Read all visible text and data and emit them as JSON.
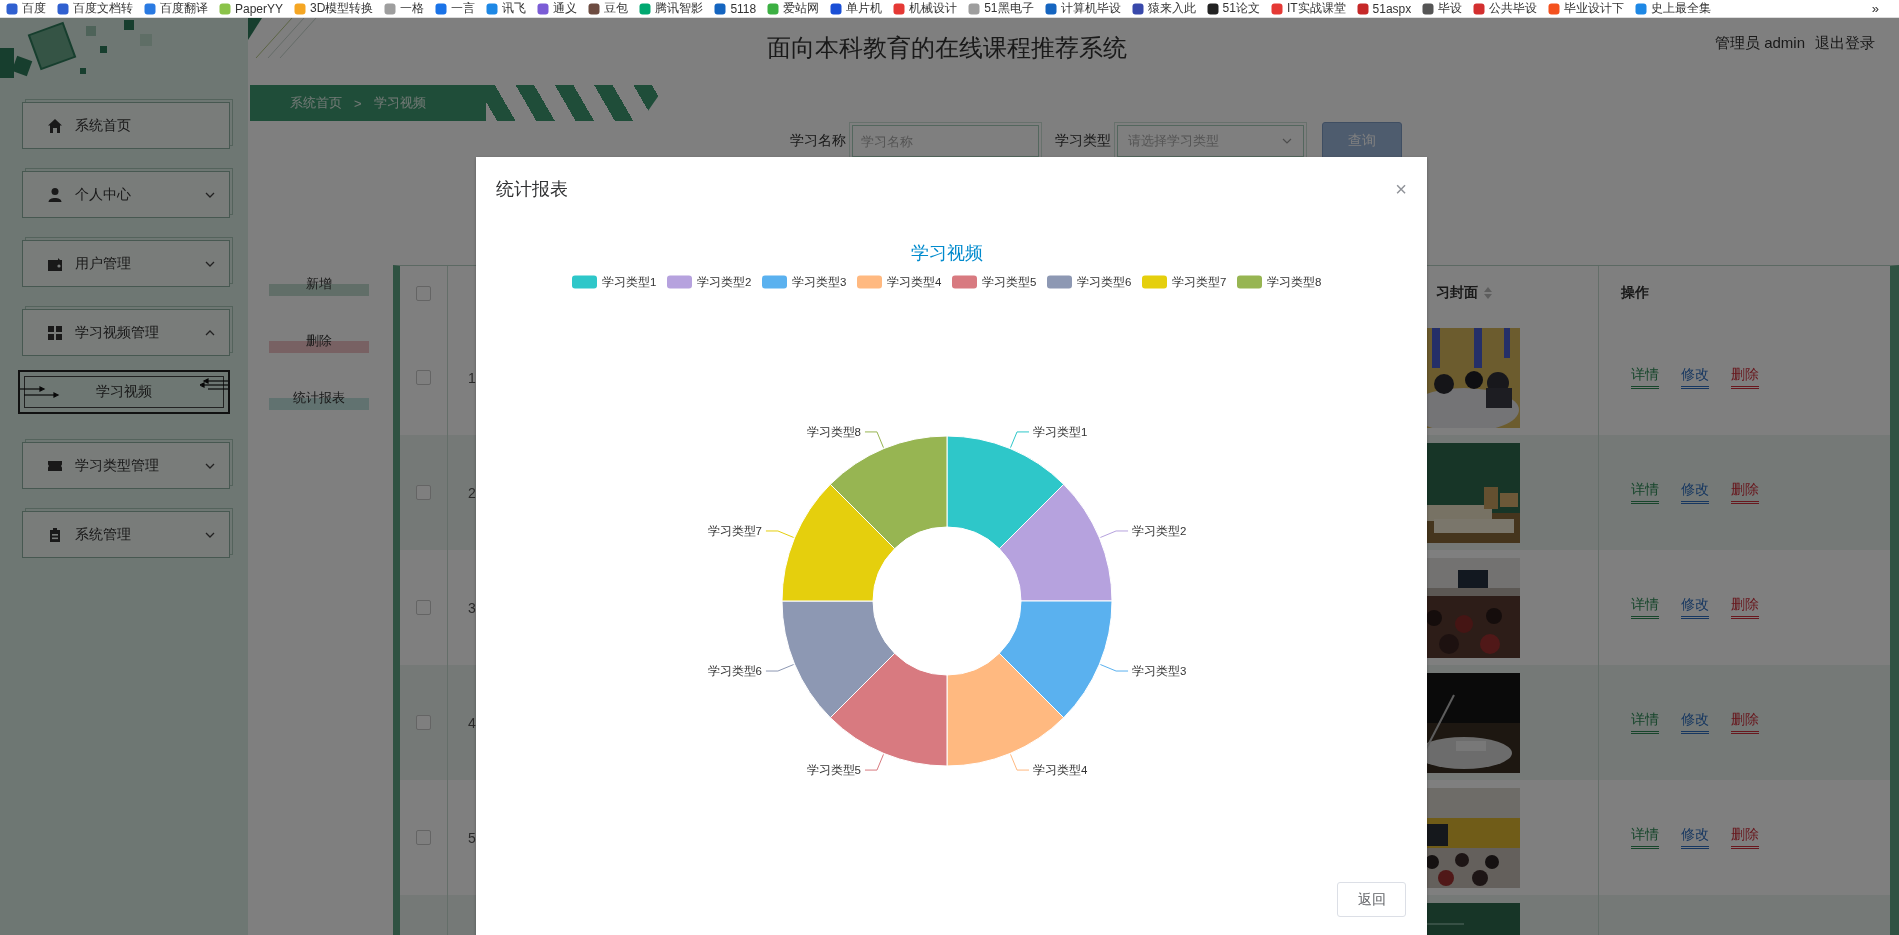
{
  "bookmarks": [
    {
      "label": "百度"
    },
    {
      "label": "百度文档转"
    },
    {
      "label": "百度翻译"
    },
    {
      "label": "PaperYY"
    },
    {
      "label": "3D模型转换"
    },
    {
      "label": "一格"
    },
    {
      "label": "一言"
    },
    {
      "label": "讯飞"
    },
    {
      "label": "通义"
    },
    {
      "label": "豆包"
    },
    {
      "label": "腾讯智影"
    },
    {
      "label": "5118"
    },
    {
      "label": "爱站网"
    },
    {
      "label": "单片机"
    },
    {
      "label": "机械设计"
    },
    {
      "label": "51黑电子"
    },
    {
      "label": "计算机毕设"
    },
    {
      "label": "猿来入此"
    },
    {
      "label": "51论文"
    },
    {
      "label": "IT实战课堂"
    },
    {
      "label": "51aspx"
    },
    {
      "label": "毕设"
    },
    {
      "label": "公共毕设"
    },
    {
      "label": "毕业设计下"
    },
    {
      "label": "史上最全集"
    }
  ],
  "bookmarks_more": "»",
  "header": {
    "title": "面向本科教育的在线课程推荐系统",
    "user": "管理员 admin",
    "logout": "退出登录"
  },
  "sidebar": {
    "items": [
      {
        "label": "系统首页",
        "kind": "link"
      },
      {
        "label": "个人中心",
        "kind": "menu",
        "expanded": false
      },
      {
        "label": "用户管理",
        "kind": "menu",
        "expanded": false
      },
      {
        "label": "学习视频管理",
        "kind": "menu",
        "expanded": true,
        "children": [
          {
            "label": "学习视频",
            "selected": true
          }
        ]
      },
      {
        "label": "学习类型管理",
        "kind": "menu",
        "expanded": false
      },
      {
        "label": "系统管理",
        "kind": "menu",
        "expanded": false
      }
    ]
  },
  "breadcrumb": {
    "items": [
      "系统首页",
      "学习视频"
    ],
    "separator": ">"
  },
  "search": {
    "fields": [
      {
        "label": "学习名称",
        "kind": "text",
        "placeholder": "学习名称"
      },
      {
        "label": "学习类型",
        "kind": "select",
        "placeholder": "请选择学习类型"
      }
    ],
    "button": "查询"
  },
  "actions": [
    {
      "label": "新增",
      "kind": "add"
    },
    {
      "label": "删除",
      "kind": "delete"
    },
    {
      "label": "统计报表",
      "kind": "report"
    }
  ],
  "table": {
    "columns": [
      {
        "kind": "checkbox",
        "checked": false
      },
      {
        "kind": "text"
      },
      {
        "kind": "sortable",
        "label": "习封面"
      },
      {
        "kind": "text",
        "label": "操作"
      }
    ],
    "rows": [
      {
        "checked": false,
        "index": "1",
        "cover": {
          "kind": "picture"
        },
        "actions": [
          {
            "label": "详情",
            "kind": "detail"
          },
          {
            "label": "修改",
            "kind": "edit"
          },
          {
            "label": "删除",
            "kind": "delete"
          }
        ]
      },
      {
        "checked": false,
        "index": "2",
        "cover": {
          "kind": "picture"
        },
        "actions": [
          {
            "label": "详情",
            "kind": "detail"
          },
          {
            "label": "修改",
            "kind": "edit"
          },
          {
            "label": "删除",
            "kind": "delete"
          }
        ]
      },
      {
        "checked": false,
        "index": "3",
        "cover": {
          "kind": "picture"
        },
        "actions": [
          {
            "label": "详情",
            "kind": "detail"
          },
          {
            "label": "修改",
            "kind": "edit"
          },
          {
            "label": "删除",
            "kind": "delete"
          }
        ]
      },
      {
        "checked": false,
        "index": "4",
        "cover": {
          "kind": "picture"
        },
        "actions": [
          {
            "label": "详情",
            "kind": "detail"
          },
          {
            "label": "修改",
            "kind": "edit"
          },
          {
            "label": "删除",
            "kind": "delete"
          }
        ]
      },
      {
        "checked": false,
        "index": "5",
        "cover": {
          "kind": "picture"
        },
        "actions": [
          {
            "label": "详情",
            "kind": "detail"
          },
          {
            "label": "修改",
            "kind": "edit"
          },
          {
            "label": "删除",
            "kind": "delete"
          }
        ]
      },
      {
        "cover": {
          "kind": "picture"
        }
      }
    ]
  },
  "modal": {
    "title": "统计报表",
    "close": "×",
    "legend": [
      {
        "label": "学习类型1",
        "color": "#2ec7c9"
      },
      {
        "label": "学习类型2",
        "color": "#b6a2de"
      },
      {
        "label": "学习类型3",
        "color": "#5ab1ef"
      },
      {
        "label": "学习类型4",
        "color": "#ffb980"
      },
      {
        "label": "学习类型5",
        "color": "#d87a80"
      },
      {
        "label": "学习类型6",
        "color": "#8d98b3"
      },
      {
        "label": "学习类型7",
        "color": "#e5cf0d"
      },
      {
        "label": "学习类型8",
        "color": "#97b552"
      }
    ],
    "chart_data": {
      "type": "donut",
      "title": "学习视频",
      "categories": [
        "学习类型1",
        "学习类型2",
        "学习类型3",
        "学习类型4",
        "学习类型5",
        "学习类型6",
        "学习类型7",
        "学习类型8"
      ],
      "values": [
        1,
        1,
        1,
        1,
        1,
        1,
        1,
        1
      ]
    },
    "buttons": [
      "返回"
    ]
  }
}
